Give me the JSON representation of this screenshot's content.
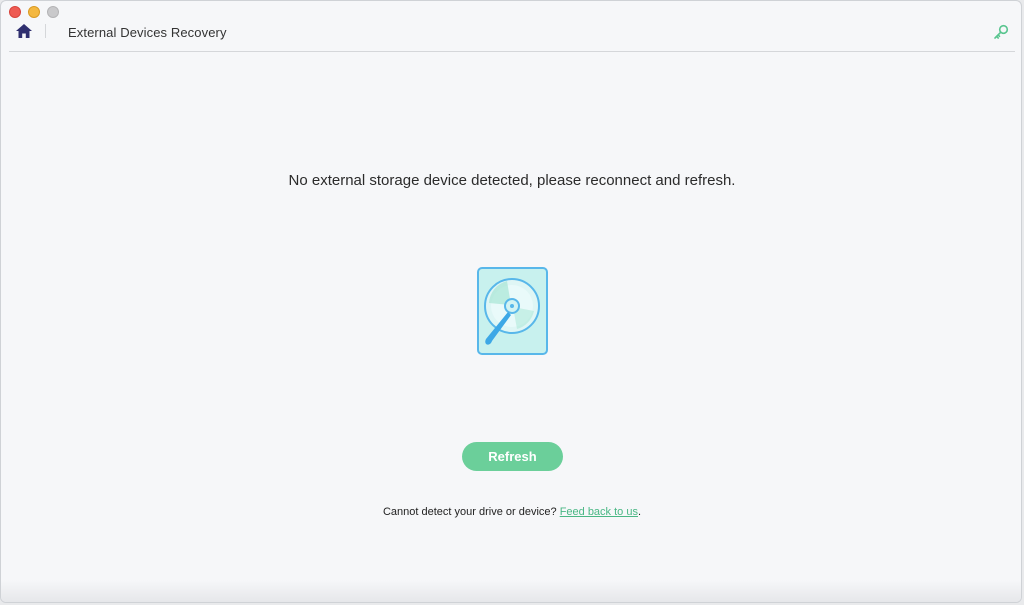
{
  "window": {
    "title": "External Devices Recovery"
  },
  "header": {
    "home_icon": "home-icon",
    "settings_icon": "key-icon"
  },
  "main": {
    "message": "No external storage device detected, please reconnect and refresh.",
    "illustration_icon": "hard-drive-icon",
    "refresh_label": "Refresh"
  },
  "footer": {
    "prompt": "Cannot detect your drive or device? ",
    "link_label": "Feed back to us",
    "suffix": "."
  },
  "colors": {
    "accent": "#6bcf9a",
    "link": "#49b784",
    "home_icon": "#2f2f6f",
    "drive_border": "#58b7ea",
    "drive_fill": "#c8f1ee"
  }
}
